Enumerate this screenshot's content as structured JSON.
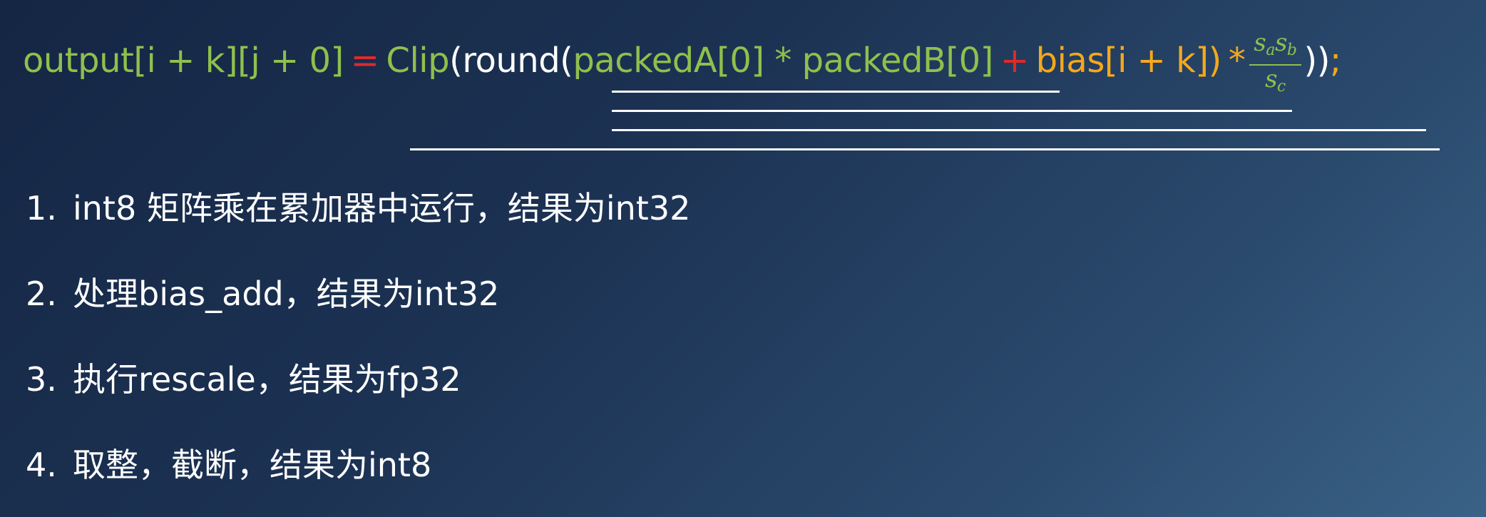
{
  "formula": {
    "output": "output[i + k][j + 0]",
    "equals": "=",
    "clip": "Clip",
    "open_paren": "(",
    "round": "round(",
    "product": "packedA[0] * packedB[0]",
    "plus": "+",
    "bias": "bias[i + k]",
    "close_round": ")",
    "times": "*",
    "frac_num_s1": "s",
    "frac_num_sub1": "a",
    "frac_num_s2": "s",
    "frac_num_sub2": "b",
    "frac_den_s": "s",
    "frac_den_sub": "c",
    "close_end": "))",
    "semicolon": ";",
    "colors": {
      "green": "#8fc04d",
      "red": "#e02a2a",
      "white": "#ffffff",
      "orange": "#f5a81c"
    }
  },
  "steps": [
    {
      "num": "1.",
      "text": "int8 矩阵乘在累加器中运行，结果为int32"
    },
    {
      "num": "2.",
      "text": "处理bias_add，结果为int32"
    },
    {
      "num": "3.",
      "text": "执行rescale，结果为fp32"
    },
    {
      "num": "4.",
      "text": "取整，截断，结果为int8"
    }
  ]
}
